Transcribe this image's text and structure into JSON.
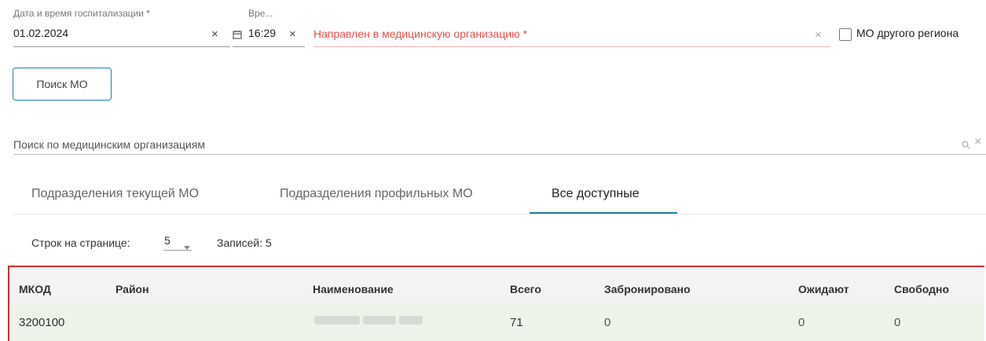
{
  "hospitalization": {
    "date_label": "Дата и время госпитализации",
    "required_mark": "*",
    "date_value": "01.02.2024",
    "time_label": "Вре...",
    "time_value": "16:29",
    "clear_glyph": "×"
  },
  "referral": {
    "label": "Направлен в медицинскую организацию",
    "required_mark": "*",
    "clear_glyph": "×",
    "other_region_label": "МО другого региона"
  },
  "search_mo_button": "Поиск МО",
  "org_search": {
    "placeholder": "Поиск по медицинским организациям",
    "clear_glyph": "×"
  },
  "tabs": [
    {
      "label": "Подразделения текущей МО",
      "active": false
    },
    {
      "label": "Подразделения профильных МО",
      "active": false
    },
    {
      "label": "Все доступные",
      "active": true
    }
  ],
  "pagination": {
    "rows_label": "Строк на странице:",
    "rows_value": "5",
    "records_label": "Записей:",
    "records_value": "5"
  },
  "table": {
    "columns": [
      "МКОД",
      "Район",
      "Наименование",
      "Всего",
      "Забронировано",
      "Ожидают",
      "Свободно"
    ],
    "rows": [
      {
        "mkod": "3200100",
        "district": "",
        "name": "",
        "total": "71",
        "booked": "0",
        "waiting": "0",
        "free": "0"
      }
    ]
  },
  "colors": {
    "accent": "#1e7ea8",
    "required_red": "#e05353",
    "highlight_frame": "#d32f2f",
    "header_bg": "#f3f3f3",
    "row_bg": "#edf3e8"
  },
  "icons": {
    "calendar": "calendar-icon",
    "search": "search-icon",
    "dropdown": "caret-down-icon",
    "checkbox": "checkbox-icon"
  }
}
